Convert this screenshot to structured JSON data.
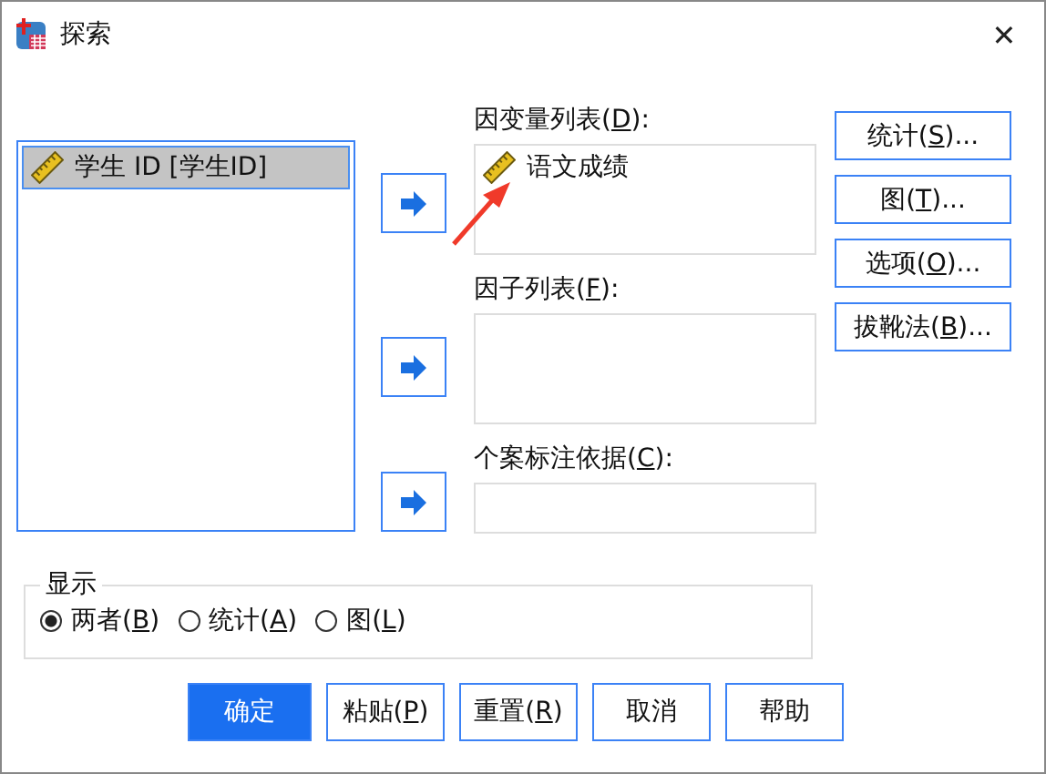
{
  "window": {
    "title": "探索",
    "close": "✕"
  },
  "source_list": {
    "items": [
      {
        "label": "学生 ID [学生ID]",
        "selected": true
      }
    ]
  },
  "targets": [
    {
      "pre": "因变量列表(",
      "key": "D",
      "post": "):",
      "items": [
        {
          "label": "语文成绩"
        }
      ],
      "kind": "list"
    },
    {
      "pre": "因子列表(",
      "key": "F",
      "post": "):",
      "kind": "list"
    },
    {
      "pre": "个案标注依据(",
      "key": "C",
      "post": "):",
      "kind": "field"
    }
  ],
  "side_buttons": [
    {
      "pre": "统计(",
      "key": "S",
      "post": ")..."
    },
    {
      "pre": "图(",
      "key": "T",
      "post": ")..."
    },
    {
      "pre": "选项(",
      "key": "O",
      "post": ")..."
    },
    {
      "pre": "拔靴法(",
      "key": "B",
      "post": ")..."
    }
  ],
  "display": {
    "title": "显示",
    "options": [
      {
        "pre": "两者(",
        "key": "B",
        "post": ")",
        "selected": true
      },
      {
        "pre": "统计(",
        "key": "A",
        "post": ")",
        "selected": false
      },
      {
        "pre": "图(",
        "key": "L",
        "post": ")",
        "selected": false
      }
    ]
  },
  "buttons": [
    {
      "pre": "确定",
      "kind": "primary"
    },
    {
      "pre": "粘贴(",
      "key": "P",
      "post": ")",
      "kind": "normal"
    },
    {
      "pre": "重置(",
      "key": "R",
      "post": ")",
      "kind": "normal"
    },
    {
      "pre": "取消",
      "kind": "normal"
    },
    {
      "pre": "帮助",
      "kind": "normal"
    }
  ]
}
